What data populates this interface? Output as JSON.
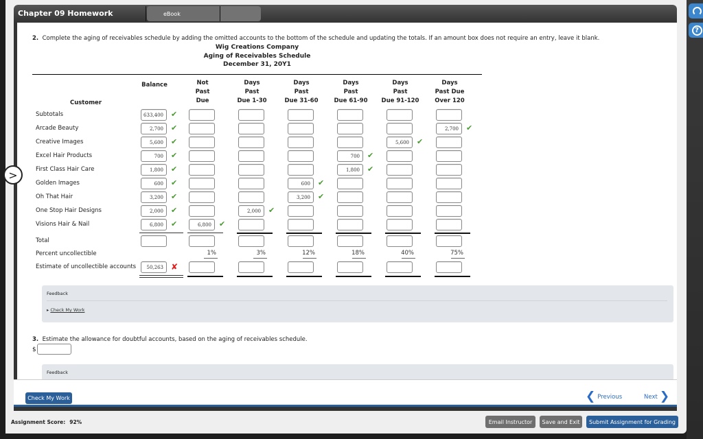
{
  "window": {
    "title": "Chapter 09 Homework",
    "tabs": [
      "eBook",
      ""
    ]
  },
  "question2": {
    "number": "2.",
    "text": "Complete the aging of receivables schedule by adding the omitted accounts to the bottom of the schedule and updating the totals. If an amount box does not require an entry, leave it blank."
  },
  "schedule": {
    "company": "Wig Creations Company",
    "title": "Aging of Receivables Schedule",
    "date": "December 31, 20Y1",
    "customer_header": "Customer",
    "columns": [
      {
        "key": "balance",
        "lines": [
          "",
          "",
          "Balance"
        ]
      },
      {
        "key": "not_past_due",
        "lines": [
          "Not",
          "Past",
          "Due"
        ]
      },
      {
        "key": "d1_30",
        "lines": [
          "Days",
          "Past",
          "Due 1-30"
        ]
      },
      {
        "key": "d31_60",
        "lines": [
          "Days",
          "Past",
          "Due 31-60"
        ]
      },
      {
        "key": "d61_90",
        "lines": [
          "Days",
          "Past",
          "Due 61-90"
        ]
      },
      {
        "key": "d91_120",
        "lines": [
          "Days",
          "Past",
          "Due 91-120"
        ]
      },
      {
        "key": "over_120",
        "lines": [
          "Days",
          "Past Due",
          "Over 120"
        ]
      }
    ],
    "rows": [
      {
        "label": "Subtotals",
        "values": [
          "633,400",
          "",
          "",
          "",
          "",
          "",
          ""
        ],
        "marks": [
          "ok",
          "",
          "",
          "",
          "",
          "",
          ""
        ]
      },
      {
        "label": "Arcade Beauty",
        "values": [
          "2,700",
          "",
          "",
          "",
          "",
          "",
          "2,700"
        ],
        "marks": [
          "ok",
          "",
          "",
          "",
          "",
          "",
          "ok"
        ]
      },
      {
        "label": "Creative Images",
        "values": [
          "5,600",
          "",
          "",
          "",
          "",
          "5,600",
          ""
        ],
        "marks": [
          "ok",
          "",
          "",
          "",
          "",
          "ok",
          ""
        ]
      },
      {
        "label": "Excel Hair Products",
        "values": [
          "700",
          "",
          "",
          "",
          "700",
          "",
          ""
        ],
        "marks": [
          "ok",
          "",
          "",
          "",
          "ok",
          "",
          ""
        ]
      },
      {
        "label": "First Class Hair Care",
        "values": [
          "1,800",
          "",
          "",
          "",
          "1,800",
          "",
          ""
        ],
        "marks": [
          "ok",
          "",
          "",
          "",
          "ok",
          "",
          ""
        ]
      },
      {
        "label": "Golden Images",
        "values": [
          "600",
          "",
          "",
          "600",
          "",
          "",
          ""
        ],
        "marks": [
          "ok",
          "",
          "",
          "ok",
          "",
          "",
          ""
        ]
      },
      {
        "label": "Oh That Hair",
        "values": [
          "3,200",
          "",
          "",
          "3,200",
          "",
          "",
          ""
        ],
        "marks": [
          "ok",
          "",
          "",
          "ok",
          "",
          "",
          ""
        ]
      },
      {
        "label": "One Stop Hair Designs",
        "values": [
          "2,000",
          "",
          "2,000",
          "",
          "",
          "",
          ""
        ],
        "marks": [
          "ok",
          "",
          "ok",
          "",
          "",
          "",
          ""
        ]
      },
      {
        "label": "Visions Hair & Nail",
        "values": [
          "6,800",
          "6,800",
          "",
          "",
          "",
          "",
          ""
        ],
        "marks": [
          "ok",
          "ok",
          "",
          "",
          "",
          "",
          ""
        ]
      }
    ],
    "total_label": "Total",
    "total_values": [
      "",
      "",
      "",
      "",
      "",
      "",
      ""
    ],
    "percent_label": "Percent uncollectible",
    "percents": [
      "",
      "1%",
      "3%",
      "12%",
      "18%",
      "40%",
      "75%"
    ],
    "estimate_label": "Estimate of uncollectible accounts",
    "estimate_values": [
      "50,263",
      "",
      "",
      "",
      "",
      "",
      ""
    ],
    "estimate_marks": [
      "bad",
      "",
      "",
      "",
      "",
      "",
      ""
    ]
  },
  "feedback1": {
    "title": "Feedback",
    "link": "Check My Work"
  },
  "question3": {
    "number": "3.",
    "text": "Estimate the allowance for doubtful accounts, based on the aging of receivables schedule.",
    "currency": "$",
    "value": ""
  },
  "feedback2": {
    "title": "Feedback"
  },
  "actions": {
    "check_my_work": "Check My Work",
    "previous": "Previous",
    "next": "Next"
  },
  "footer": {
    "score_label": "Assignment Score:",
    "score_value": "92%",
    "email_instructor": "Email Instructor",
    "save_and_exit": "Save and Exit",
    "submit": "Submit Assignment for Grading"
  },
  "icons": {
    "ok_mark": "✔",
    "bad_mark": "✘",
    "expand": ">",
    "prev_chevron": "❮",
    "next_chevron": "❯",
    "help": "?"
  }
}
